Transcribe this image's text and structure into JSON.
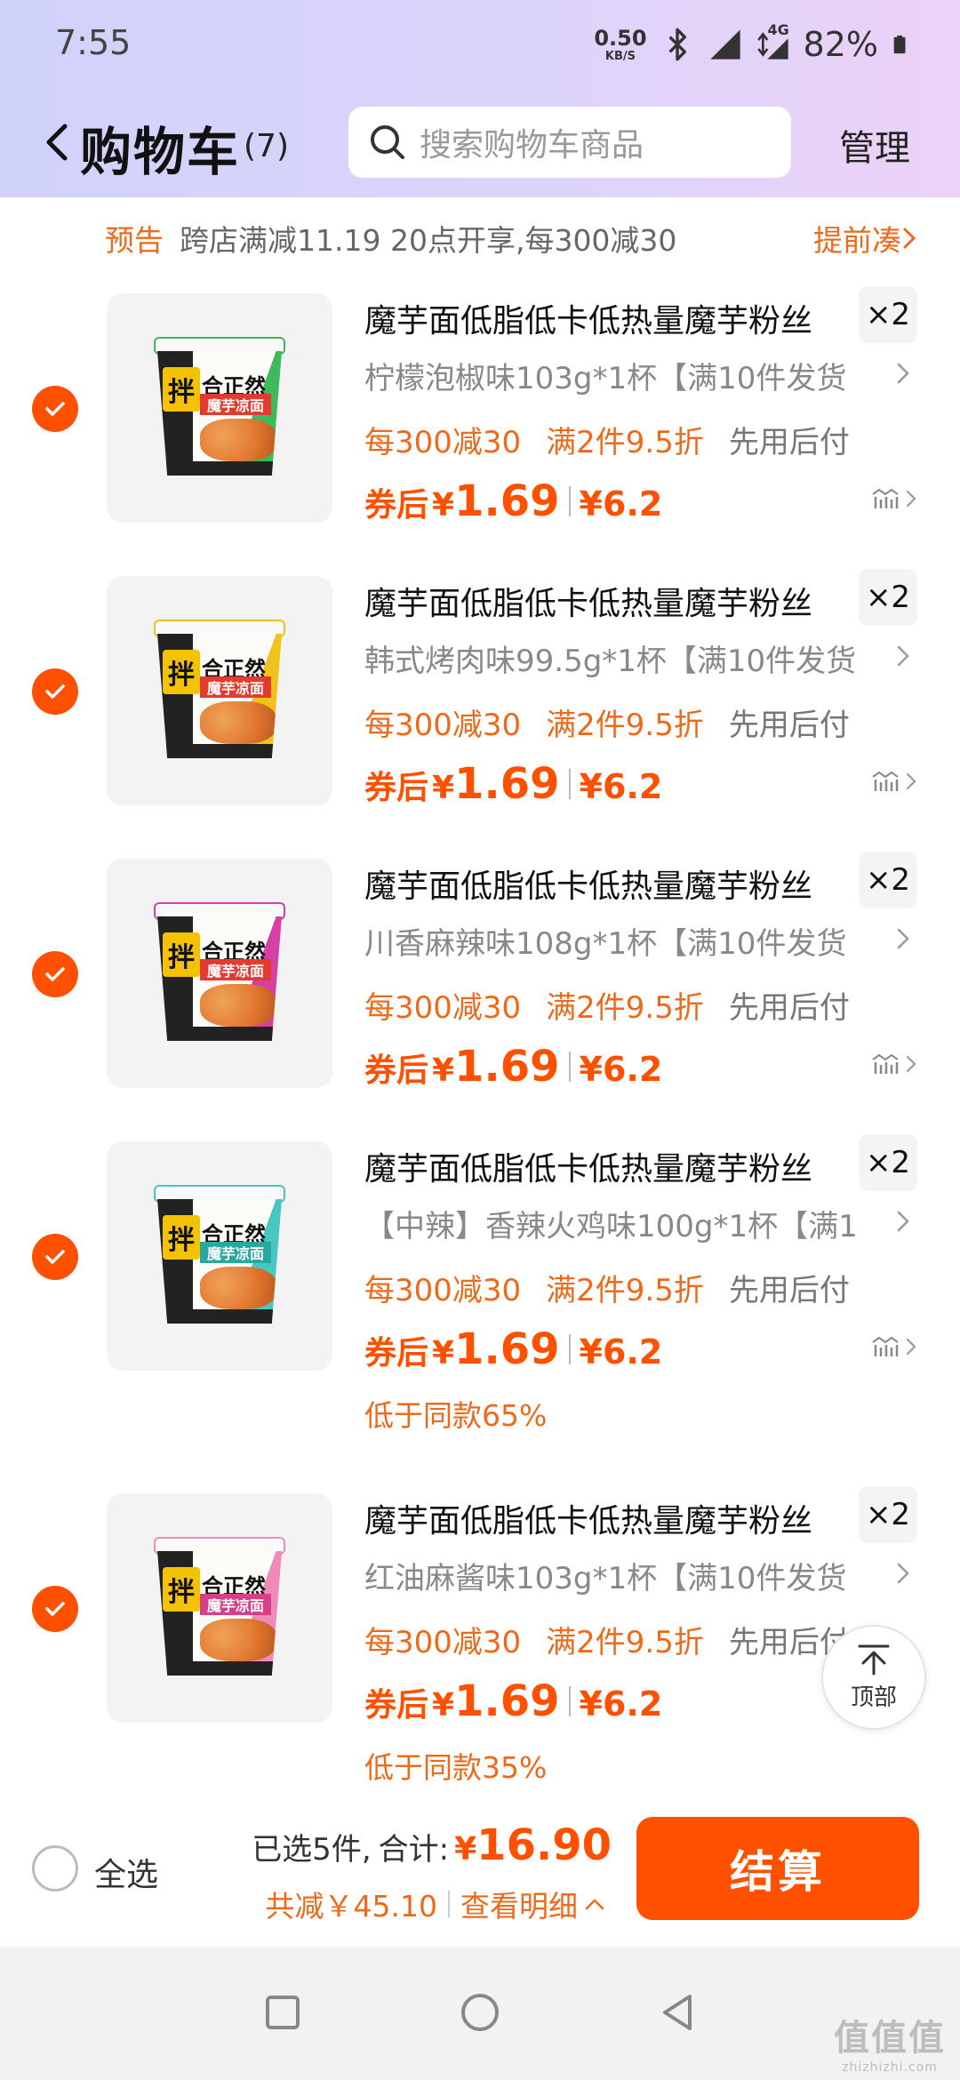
{
  "status_bar": {
    "time": "7:55",
    "net_speed_value": "0.50",
    "net_speed_unit": "KB/S",
    "network_type": "4G",
    "battery": "82%"
  },
  "header": {
    "back_icon": "chevron-left-icon",
    "title": "购物车",
    "count": "(7)",
    "search_placeholder": "搜索购物车商品",
    "manage": "管理"
  },
  "notice": {
    "tag": "预告",
    "text": "跨店满减11.19 20点开享,每300减30",
    "link": "提前凑"
  },
  "items": [
    {
      "title": "魔芋面低脂低卡低热量魔芋粉丝",
      "qty": "×2",
      "variant": "柠檬泡椒味103g*1杯【满10件发货",
      "promo1": "每300减30",
      "promo2": "满2件9.5折",
      "promo3": "先用后付",
      "coupon_label": "券后",
      "currency": "¥",
      "coupon_price": "1.69",
      "original_price": "¥6.2",
      "lower_note": "",
      "cup": {
        "brand": "合正然",
        "sub": "魔芋凉面",
        "sub_color": "#e33b2f",
        "accent": "#3dbb5a"
      }
    },
    {
      "title": "魔芋面低脂低卡低热量魔芋粉丝",
      "qty": "×2",
      "variant": "韩式烤肉味99.5g*1杯【满10件发货",
      "promo1": "每300减30",
      "promo2": "满2件9.5折",
      "promo3": "先用后付",
      "coupon_label": "券后",
      "currency": "¥",
      "coupon_price": "1.69",
      "original_price": "¥6.2",
      "lower_note": "",
      "cup": {
        "brand": "合正然",
        "sub": "魔芋凉面",
        "sub_color": "#e33b2f",
        "accent": "#f1c21b"
      }
    },
    {
      "title": "魔芋面低脂低卡低热量魔芋粉丝",
      "qty": "×2",
      "variant": "川香麻辣味108g*1杯【满10件发货",
      "promo1": "每300减30",
      "promo2": "满2件9.5折",
      "promo3": "先用后付",
      "coupon_label": "券后",
      "currency": "¥",
      "coupon_price": "1.69",
      "original_price": "¥6.2",
      "lower_note": "",
      "cup": {
        "brand": "合正然",
        "sub": "魔芋凉面",
        "sub_color": "#e33b2f",
        "accent": "#d63fa4"
      }
    },
    {
      "title": "魔芋面低脂低卡低热量魔芋粉丝",
      "qty": "×2",
      "variant": "【中辣】香辣火鸡味100g*1杯【满1",
      "promo1": "每300减30",
      "promo2": "满2件9.5折",
      "promo3": "先用后付",
      "coupon_label": "券后",
      "currency": "¥",
      "coupon_price": "1.69",
      "original_price": "¥6.2",
      "lower_note": "低于同款65%",
      "cup": {
        "brand": "合正然",
        "sub": "魔芋凉面",
        "sub_color": "#2aa7a0",
        "accent": "#48c7c0"
      }
    },
    {
      "title": "魔芋面低脂低卡低热量魔芋粉丝",
      "qty": "×2",
      "variant": "红油麻酱味103g*1杯【满10件发货",
      "promo1": "每300减30",
      "promo2": "满2件9.5折",
      "promo3": "先用后付",
      "coupon_label": "券后",
      "currency": "¥",
      "coupon_price": "1.69",
      "original_price": "¥6.2",
      "lower_note": "低于同款35%",
      "cup": {
        "brand": "合正然",
        "sub": "魔芋凉面",
        "sub_color": "#d63f8a",
        "accent": "#f08ab8"
      }
    }
  ],
  "back_to_top": "顶部",
  "checkout": {
    "select_all": "全选",
    "selected": "已选5件,",
    "total_label": "合计:",
    "currency": "¥",
    "total": "16.90",
    "saved": "共减￥45.10",
    "detail": "查看明细",
    "pay": "结算"
  },
  "watermark": {
    "big": "值值值",
    "small": "zhizhizhi.com"
  },
  "colors": {
    "accent": "#ff5000",
    "promo": "#ee6a1a",
    "header_start": "#d0d2fb",
    "header_end": "#ecd2f6"
  }
}
